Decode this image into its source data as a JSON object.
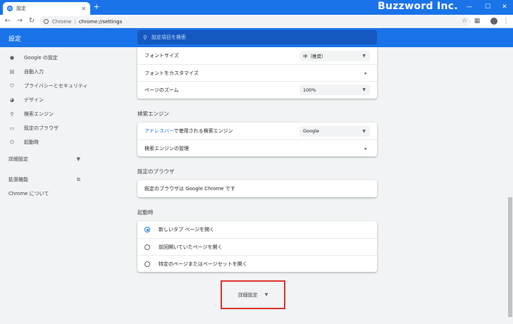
{
  "window": {
    "tab_title": "設定",
    "watermark": "Buzzword Inc."
  },
  "toolbar": {
    "site_label": "Chrome",
    "url": "chrome://settings"
  },
  "header": {
    "title": "設定",
    "search_placeholder": "設定項目を検索"
  },
  "sidebar": {
    "items": [
      {
        "icon": "person-icon",
        "label": "Google の設定"
      },
      {
        "icon": "assignment-icon",
        "label": "自動入力"
      },
      {
        "icon": "shield-icon",
        "label": "プライバシーとセキュリティ"
      },
      {
        "icon": "palette-icon",
        "label": "デザイン"
      },
      {
        "icon": "search-icon",
        "label": "検索エンジン"
      },
      {
        "icon": "browser-icon",
        "label": "既定のブラウザ"
      },
      {
        "icon": "power-icon",
        "label": "起動時"
      }
    ],
    "advanced_label": "詳細設定",
    "extensions_label": "拡張機能",
    "about_label": "Chrome について"
  },
  "appearance": {
    "font_size_label": "フォントサイズ",
    "font_size_value": "中（推奨）",
    "customize_fonts_label": "フォントをカスタマイズ",
    "page_zoom_label": "ページのズーム",
    "page_zoom_value": "100%"
  },
  "search_engine": {
    "section_title": "検索エンジン",
    "address_bar_link": "アドレスバー",
    "address_bar_rest": "で使用される検索エンジン",
    "engine_value": "Google",
    "manage_label": "検索エンジンの管理"
  },
  "default_browser": {
    "section_title": "既定のブラウザ",
    "status_text": "既定のブラウザは Google Chrome です"
  },
  "on_startup": {
    "section_title": "起動時",
    "options": [
      {
        "label": "新しいタブ ページを開く",
        "selected": true
      },
      {
        "label": "前回開いていたページを開く",
        "selected": false
      },
      {
        "label": "特定のページまたはページセットを開く",
        "selected": false
      }
    ]
  },
  "advanced_button": {
    "label": "詳細設定"
  },
  "colors": {
    "accent": "#1a73e8",
    "highlight_box": "#d93025"
  }
}
